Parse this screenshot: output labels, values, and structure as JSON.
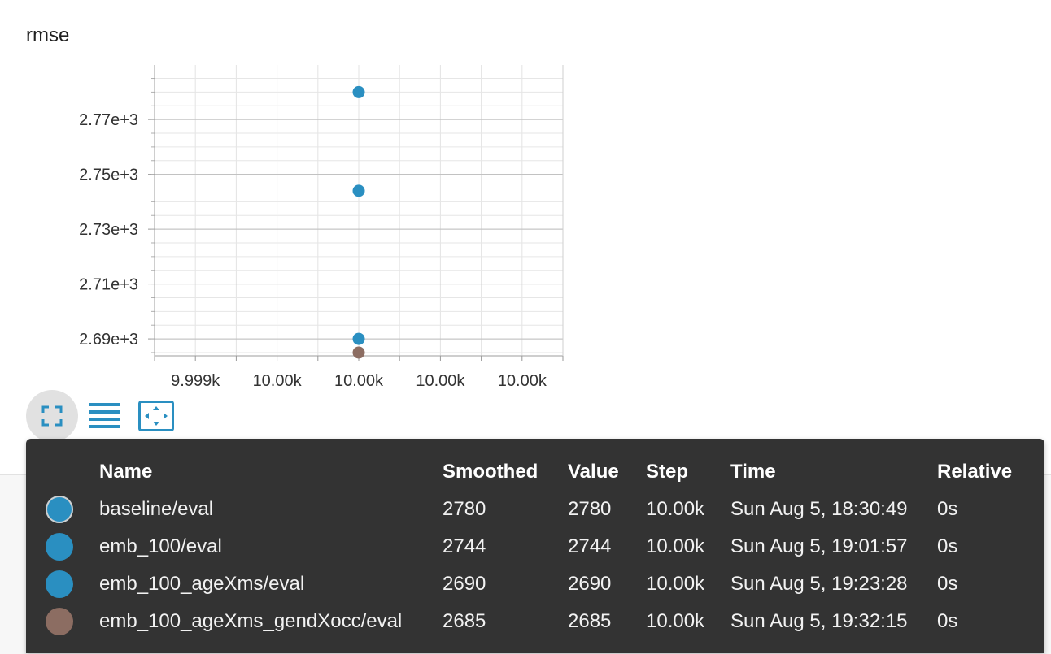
{
  "card": {
    "title": "rmse"
  },
  "chart_data": {
    "type": "scatter",
    "title": "rmse",
    "xlabel": "",
    "ylabel": "",
    "x_ticks": [
      "9.999k",
      "10.00k",
      "10.00k",
      "10.00k",
      "10.00k"
    ],
    "y_ticks": [
      2690,
      2710,
      2730,
      2750,
      2770
    ],
    "y_tick_labels": [
      "2.69e+3",
      "2.71e+3",
      "2.73e+3",
      "2.75e+3",
      "2.77e+3"
    ],
    "ylim": [
      2683.8,
      2789.9
    ],
    "grid": true,
    "series": [
      {
        "name": "baseline/eval",
        "x": [
          10000
        ],
        "y": [
          2780
        ],
        "color": "#2a8fc1"
      },
      {
        "name": "emb_100/eval",
        "x": [
          10000
        ],
        "y": [
          2744
        ],
        "color": "#2a8fc1"
      },
      {
        "name": "emb_100_ageXms/eval",
        "x": [
          10000
        ],
        "y": [
          2690
        ],
        "color": "#2a8fc1"
      },
      {
        "name": "emb_100_ageXms_gendXocc/eval",
        "x": [
          10000
        ],
        "y": [
          2685
        ],
        "color": "#8c6d62"
      }
    ]
  },
  "toolbar": {
    "buttons": [
      {
        "name": "expand-chart-button",
        "icon": "fullscreen-icon"
      },
      {
        "name": "toggle-log-scale-button",
        "icon": "list-lines-icon"
      },
      {
        "name": "fit-domain-button",
        "icon": "fit-to-data-icon"
      }
    ]
  },
  "tooltip": {
    "columns": {
      "name": "Name",
      "smoothed": "Smoothed",
      "value": "Value",
      "step": "Step",
      "time": "Time",
      "relative": "Relative"
    },
    "rows": [
      {
        "color": "#2a8fc1",
        "name": "baseline/eval",
        "smoothed": "2780",
        "value": "2780",
        "step": "10.00k",
        "time": "Sun Aug 5, 18:30:49",
        "relative": "0s"
      },
      {
        "color": "#2a8fc1",
        "name": "emb_100/eval",
        "smoothed": "2744",
        "value": "2744",
        "step": "10.00k",
        "time": "Sun Aug 5, 19:01:57",
        "relative": "0s"
      },
      {
        "color": "#2a8fc1",
        "name": "emb_100_ageXms/eval",
        "smoothed": "2690",
        "value": "2690",
        "step": "10.00k",
        "time": "Sun Aug 5, 19:23:28",
        "relative": "0s"
      },
      {
        "color": "#8c6d62",
        "name": "emb_100_ageXms_gendXocc/eval",
        "smoothed": "2685",
        "value": "2685",
        "step": "10.00k",
        "time": "Sun Aug 5, 19:32:15",
        "relative": "0s"
      }
    ]
  },
  "colors": {
    "accent": "#2a8fc1",
    "tooltip_bg": "#333333"
  }
}
